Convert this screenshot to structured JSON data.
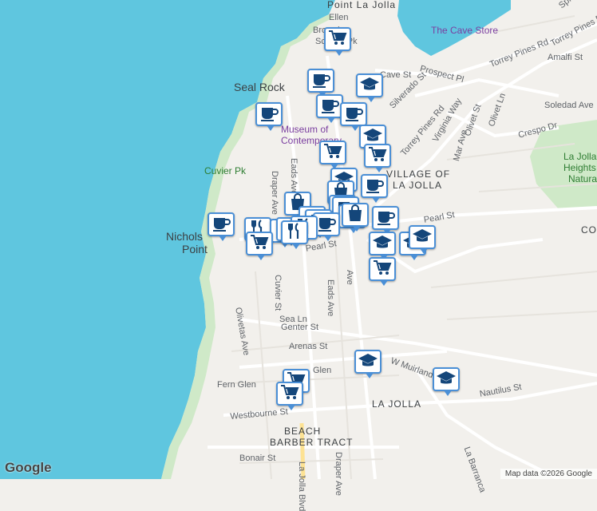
{
  "map": {
    "labels": [
      {
        "text": "Point La Jolla",
        "cls": "area"
      },
      {
        "text": "Ellen",
        "cls": ""
      },
      {
        "text": "Browning",
        "cls": ""
      },
      {
        "text": "Scripps Pk",
        "cls": ""
      },
      {
        "text": "The Cave Store",
        "cls": "poi"
      },
      {
        "text": "Seal Rock",
        "cls": "big"
      },
      {
        "text": "Museum of",
        "cls": "poi"
      },
      {
        "text": "Contemporary",
        "cls": "poi"
      },
      {
        "text": "Cuvier Pk",
        "cls": "park"
      },
      {
        "text": "Nichols",
        "cls": "big"
      },
      {
        "text": "Point",
        "cls": "big"
      },
      {
        "text": "Prospect Pl",
        "cls": ""
      },
      {
        "text": "Torrey Pines Rd",
        "cls": ""
      },
      {
        "text": "Torrey Pines Rd",
        "cls": ""
      },
      {
        "text": "Torrey Pines Rd",
        "cls": ""
      },
      {
        "text": "Amalfi St",
        "cls": ""
      },
      {
        "text": "Soledad Ave",
        "cls": ""
      },
      {
        "text": "Crespo Dr",
        "cls": ""
      },
      {
        "text": "Virginia Way",
        "cls": ""
      },
      {
        "text": "Olivet St",
        "cls": ""
      },
      {
        "text": "Olivet Ln",
        "cls": ""
      },
      {
        "text": "Mar Ave",
        "cls": ""
      },
      {
        "text": "Silverado St",
        "cls": ""
      },
      {
        "text": "Cave St",
        "cls": ""
      },
      {
        "text": "VILLAGE OF",
        "cls": "area"
      },
      {
        "text": "LA JOLLA",
        "cls": "area"
      },
      {
        "text": "La Jolla",
        "cls": "park"
      },
      {
        "text": "Heights",
        "cls": "park"
      },
      {
        "text": "Natural P",
        "cls": "park"
      },
      {
        "text": "Pearl St",
        "cls": ""
      },
      {
        "text": "Pearl St",
        "cls": ""
      },
      {
        "text": "Eads Ave",
        "cls": ""
      },
      {
        "text": "Eads Ave",
        "cls": ""
      },
      {
        "text": "Draper Ave",
        "cls": ""
      },
      {
        "text": "Draper Ave",
        "cls": ""
      },
      {
        "text": "Cuvier St",
        "cls": ""
      },
      {
        "text": "Olivetas Ave",
        "cls": ""
      },
      {
        "text": "Sea Ln",
        "cls": ""
      },
      {
        "text": "Genter St",
        "cls": ""
      },
      {
        "text": "Arenas St",
        "cls": ""
      },
      {
        "text": "Fern Glen",
        "cls": ""
      },
      {
        "text": "Glen",
        "cls": ""
      },
      {
        "text": "W Muirlands",
        "cls": ""
      },
      {
        "text": "Nautilus St",
        "cls": ""
      },
      {
        "text": "LA JOLLA",
        "cls": "area"
      },
      {
        "text": "Westbourne St",
        "cls": ""
      },
      {
        "text": "BEACH",
        "cls": "area"
      },
      {
        "text": "BARBER TRACT",
        "cls": "area"
      },
      {
        "text": "Bonair St",
        "cls": ""
      },
      {
        "text": "La Barranca",
        "cls": ""
      },
      {
        "text": "Ave",
        "cls": ""
      },
      {
        "text": "Spindrift",
        "cls": ""
      },
      {
        "text": "CO",
        "cls": "area"
      },
      {
        "text": "La Jolla Blvd",
        "cls": ""
      }
    ],
    "markers": [
      {
        "icon": "cart-icon"
      },
      {
        "icon": "coffee-icon"
      },
      {
        "icon": "school-icon"
      },
      {
        "icon": "coffee-icon"
      },
      {
        "icon": "coffee-icon"
      },
      {
        "icon": "coffee-icon"
      },
      {
        "icon": "school-icon"
      },
      {
        "icon": "cart-icon"
      },
      {
        "icon": "cart-icon"
      },
      {
        "icon": "school-icon"
      },
      {
        "icon": "coffee-icon"
      },
      {
        "icon": "bag-icon"
      },
      {
        "icon": "bag-icon"
      },
      {
        "icon": "bag-icon"
      },
      {
        "icon": "coffee-icon"
      },
      {
        "icon": "bag-icon"
      },
      {
        "icon": "coffee-icon"
      },
      {
        "icon": "coffee-icon"
      },
      {
        "icon": "coffee-icon"
      },
      {
        "icon": "utensils-icon"
      },
      {
        "icon": "utensils-icon"
      },
      {
        "icon": "utensils-icon"
      },
      {
        "icon": "cart-icon"
      },
      {
        "icon": "utensils-icon"
      },
      {
        "icon": "utensils-icon"
      },
      {
        "icon": "coffee-icon"
      },
      {
        "icon": "bag-icon"
      },
      {
        "icon": "coffee-icon"
      },
      {
        "icon": "school-icon"
      },
      {
        "icon": "school-icon"
      },
      {
        "icon": "school-icon"
      },
      {
        "icon": "cart-icon"
      },
      {
        "icon": "school-icon"
      },
      {
        "icon": "school-icon"
      },
      {
        "icon": "cart-icon"
      },
      {
        "icon": "cart-icon"
      }
    ],
    "attribution": {
      "logo": "Google",
      "copyright": "Map data ©2026 Google"
    },
    "colors": {
      "water": "#5fc6df",
      "land": "#f2f0ec",
      "park": "#cfe9c8",
      "road": "#ffffff",
      "pin_border": "#4a8fd6",
      "icon": "#14467a"
    }
  }
}
